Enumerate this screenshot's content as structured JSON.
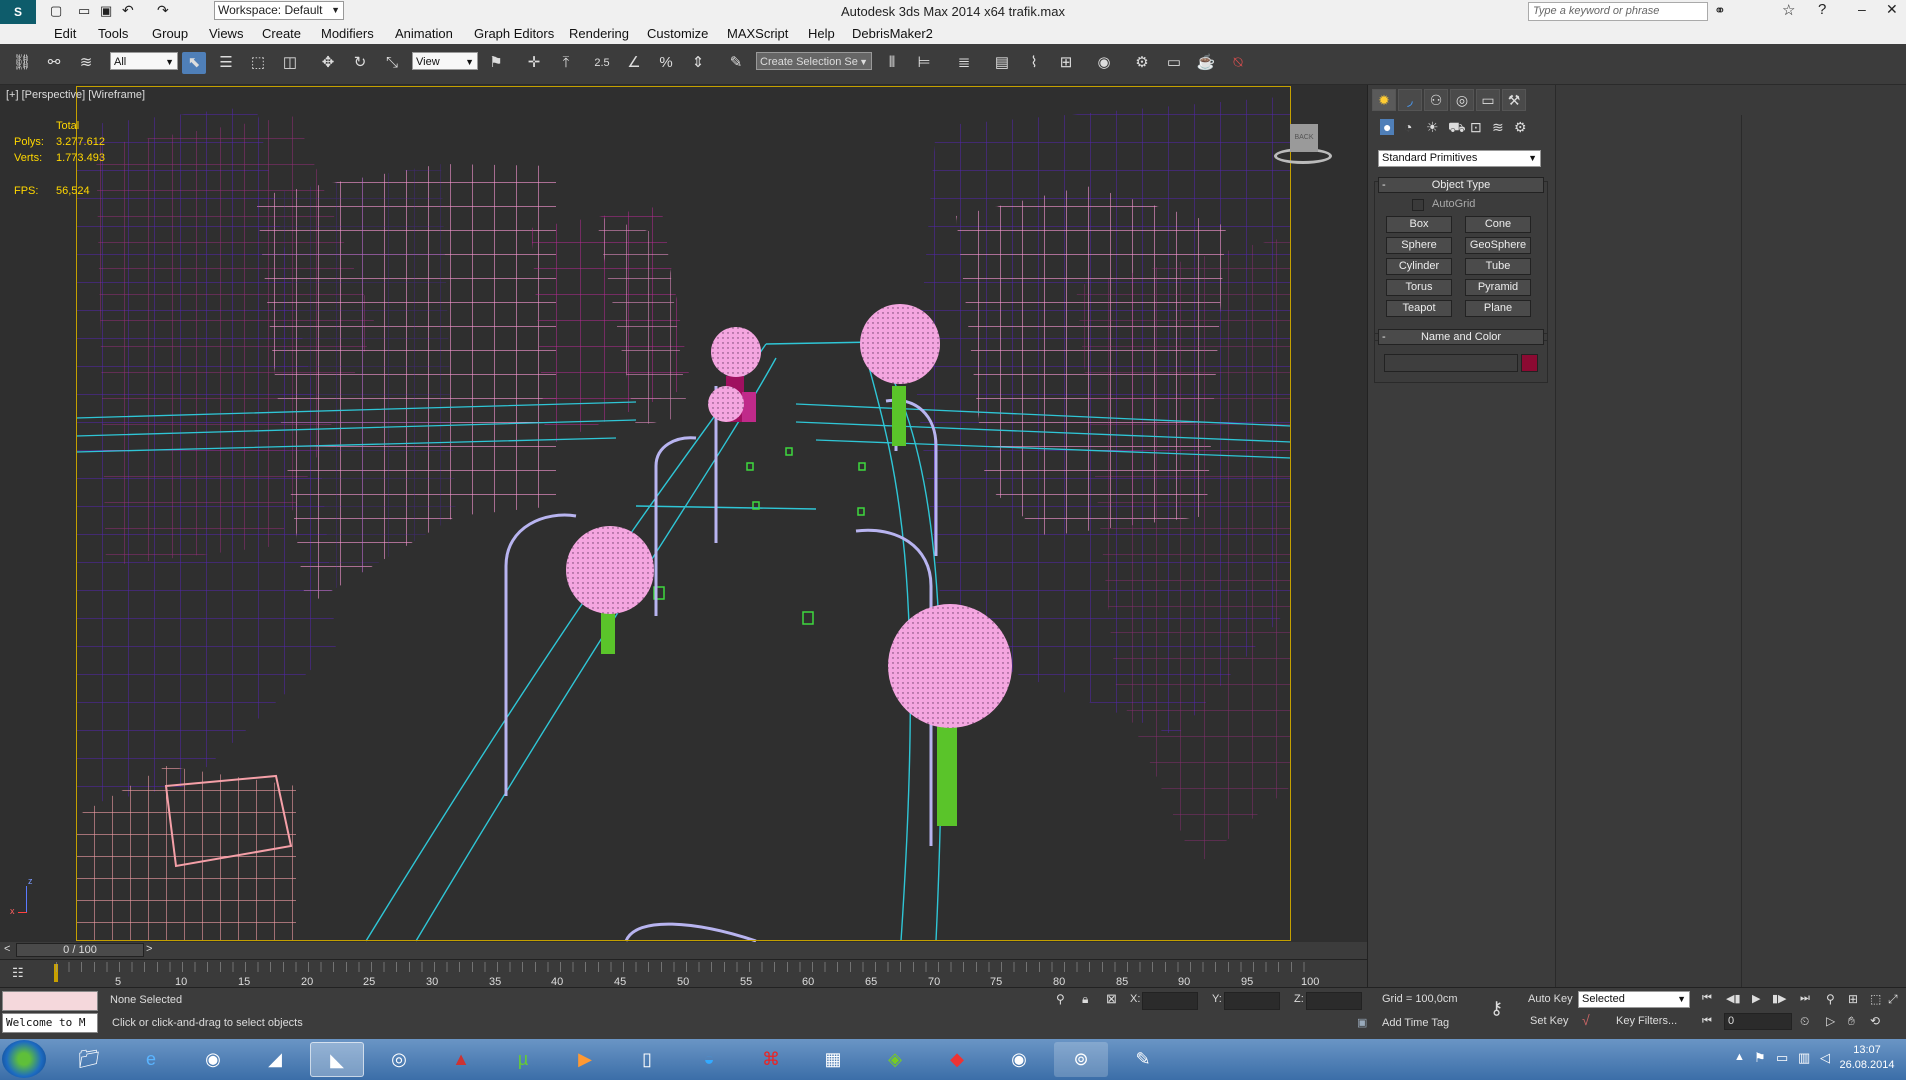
{
  "window": {
    "title": "Autodesk 3ds Max  2014 x64     trafik.max",
    "workspace": "Workspace: Default",
    "search_placeholder": "Type a keyword or phrase"
  },
  "menu": [
    "Edit",
    "Tools",
    "Group",
    "Views",
    "Create",
    "Modifiers",
    "Animation",
    "Graph Editors",
    "Rendering",
    "Customize",
    "MAXScript",
    "Help",
    "DebrisMaker2"
  ],
  "toolbar": {
    "filter_value": "All",
    "refcoord_value": "View",
    "snap_value": "2.5",
    "selection_set_placeholder": "Create Selection Se"
  },
  "viewport": {
    "label": "[+] [Perspective] [Wireframe]",
    "stats_header": "Total",
    "polys_label": "Polys:",
    "polys_value": "3.277.612",
    "verts_label": "Verts:",
    "verts_value": "1.773.493",
    "fps_label": "FPS:",
    "fps_value": "56,524",
    "viewcube_label": "BACK",
    "axis_z": "z",
    "axis_x": "x"
  },
  "command_panel": {
    "category_dropdown": "Standard Primitives",
    "object_type_title": "Object Type",
    "autogrid_label": "AutoGrid",
    "autogrid_checked": false,
    "primitives": [
      [
        "Box",
        "Cone"
      ],
      [
        "Sphere",
        "GeoSphere"
      ],
      [
        "Cylinder",
        "Tube"
      ],
      [
        "Torus",
        "Pyramid"
      ],
      [
        "Teapot",
        "Plane"
      ]
    ],
    "name_color_title": "Name and Color",
    "object_color": "#8b0a32"
  },
  "timeline": {
    "frame_counter": "0 / 100",
    "ticks": [
      "5",
      "10",
      "15",
      "20",
      "25",
      "30",
      "35",
      "40",
      "45",
      "50",
      "55",
      "60",
      "65",
      "70",
      "75",
      "80",
      "85",
      "90",
      "95",
      "100"
    ]
  },
  "status": {
    "selection": "None Selected",
    "prompt": "Click or click-and-drag to select objects",
    "maxscript_listener": "Welcome to M",
    "x_label": "X:",
    "y_label": "Y:",
    "z_label": "Z:",
    "grid": "Grid = 100,0cm",
    "add_time_tag": "Add Time Tag",
    "auto_key": "Auto Key",
    "set_key": "Set Key",
    "key_mode_value": "Selected",
    "key_filters": "Key Filters...",
    "current_frame": "0"
  },
  "taskbar": {
    "time": "13:07",
    "date": "26.08.2014"
  },
  "colors": {
    "viewport_border": "#c4a000",
    "stats_text": "#ffd700",
    "building_pink": "#ff9ad8",
    "building_purple": "#6a1fd0",
    "road_cyan": "#2fc6d6",
    "tree_pink": "#f4a6e0",
    "trunk_green": "#5ac42a",
    "lamp_lavender": "#b8b4f0"
  }
}
